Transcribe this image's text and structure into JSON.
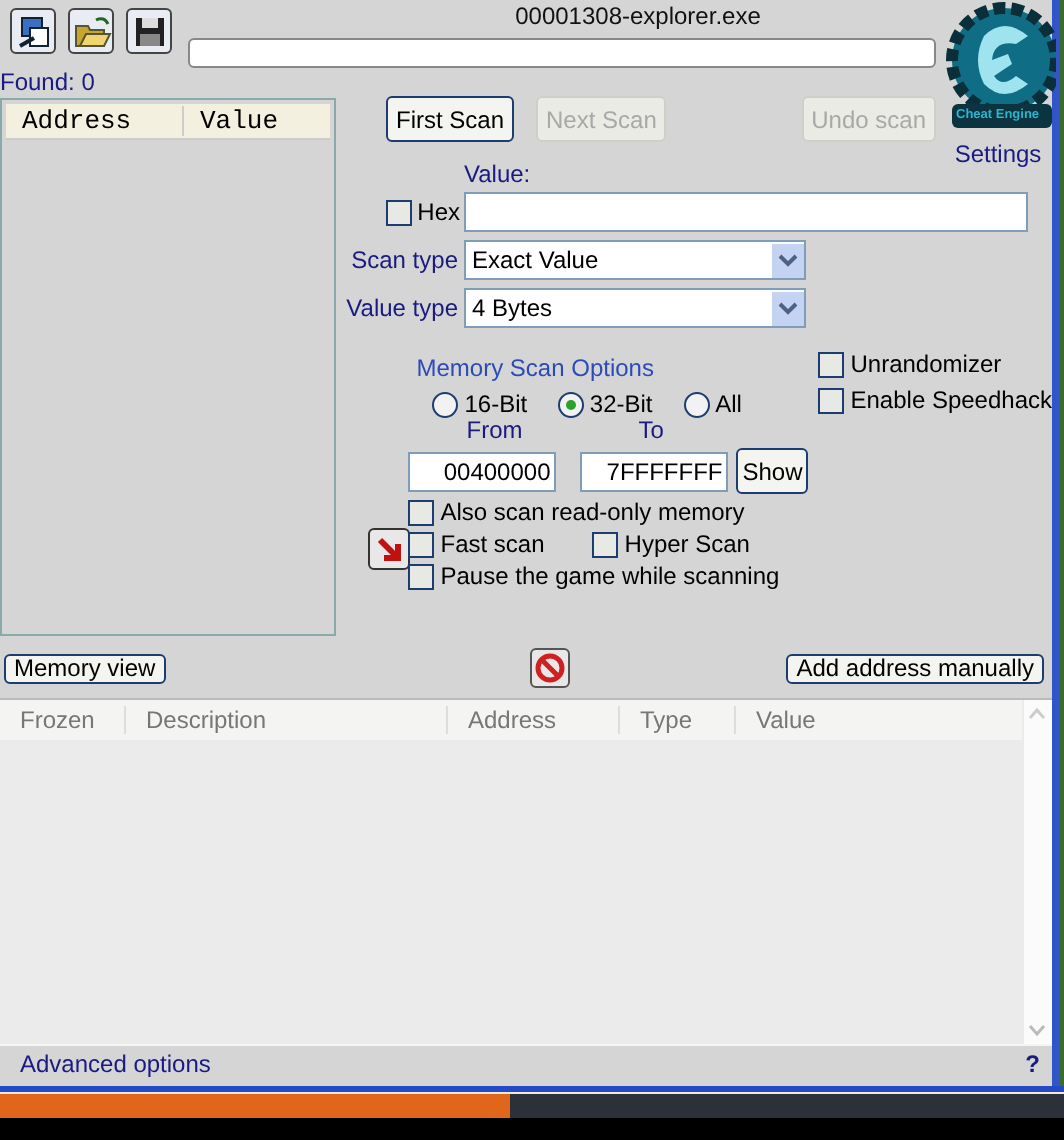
{
  "window": {
    "process_title": "00001308-explorer.exe",
    "found": "Found: 0",
    "settings_link": "Settings",
    "logo_text": "Cheat Engine",
    "progress": {
      "level": 0
    }
  },
  "results_list": {
    "columns": [
      "Address",
      "Value"
    ]
  },
  "scan_buttons": [
    {
      "label": "First Scan",
      "disabled": false
    },
    {
      "label": "Next Scan",
      "disabled": true
    },
    {
      "label": "Undo scan",
      "disabled": true
    }
  ],
  "value": {
    "label": "Value:",
    "hex": {
      "label": "Hex",
      "checked": false
    }
  },
  "scan_type": {
    "label": "Scan type",
    "value": "Exact Value"
  },
  "value_type": {
    "label": "Value type",
    "value": "4 Bytes"
  },
  "memory_scan_options": {
    "title": "Memory Scan Options",
    "bit_options": [
      {
        "label": "16-Bit",
        "selected": false
      },
      {
        "label": "32-Bit",
        "selected": true
      },
      {
        "label": "All",
        "selected": false
      }
    ],
    "from": {
      "label": "From",
      "value": "00400000"
    },
    "to": {
      "label": "To",
      "value": "7FFFFFFF"
    },
    "show_button": "Show"
  },
  "scan_option_rows": [
    [
      {
        "label": "Also scan read-only memory",
        "checked": false
      }
    ],
    [
      {
        "label": "Fast scan",
        "checked": false
      },
      {
        "label": "Hyper Scan",
        "checked": false
      }
    ],
    [
      {
        "label": "Pause the game while scanning",
        "checked": false
      }
    ]
  ],
  "extra_options": [
    {
      "label": "Unrandomizer",
      "checked": false
    },
    {
      "label": "Enable Speedhack",
      "checked": false
    }
  ],
  "memory_view_button": "Memory view",
  "add_address_button": "Add address manually",
  "address_list": {
    "columns": [
      "Frozen",
      "Description",
      "Address",
      "Type",
      "Value"
    ]
  },
  "advanced_options": "Advanced options",
  "help": "?",
  "taskbar": {
    "level": 0.48
  }
}
